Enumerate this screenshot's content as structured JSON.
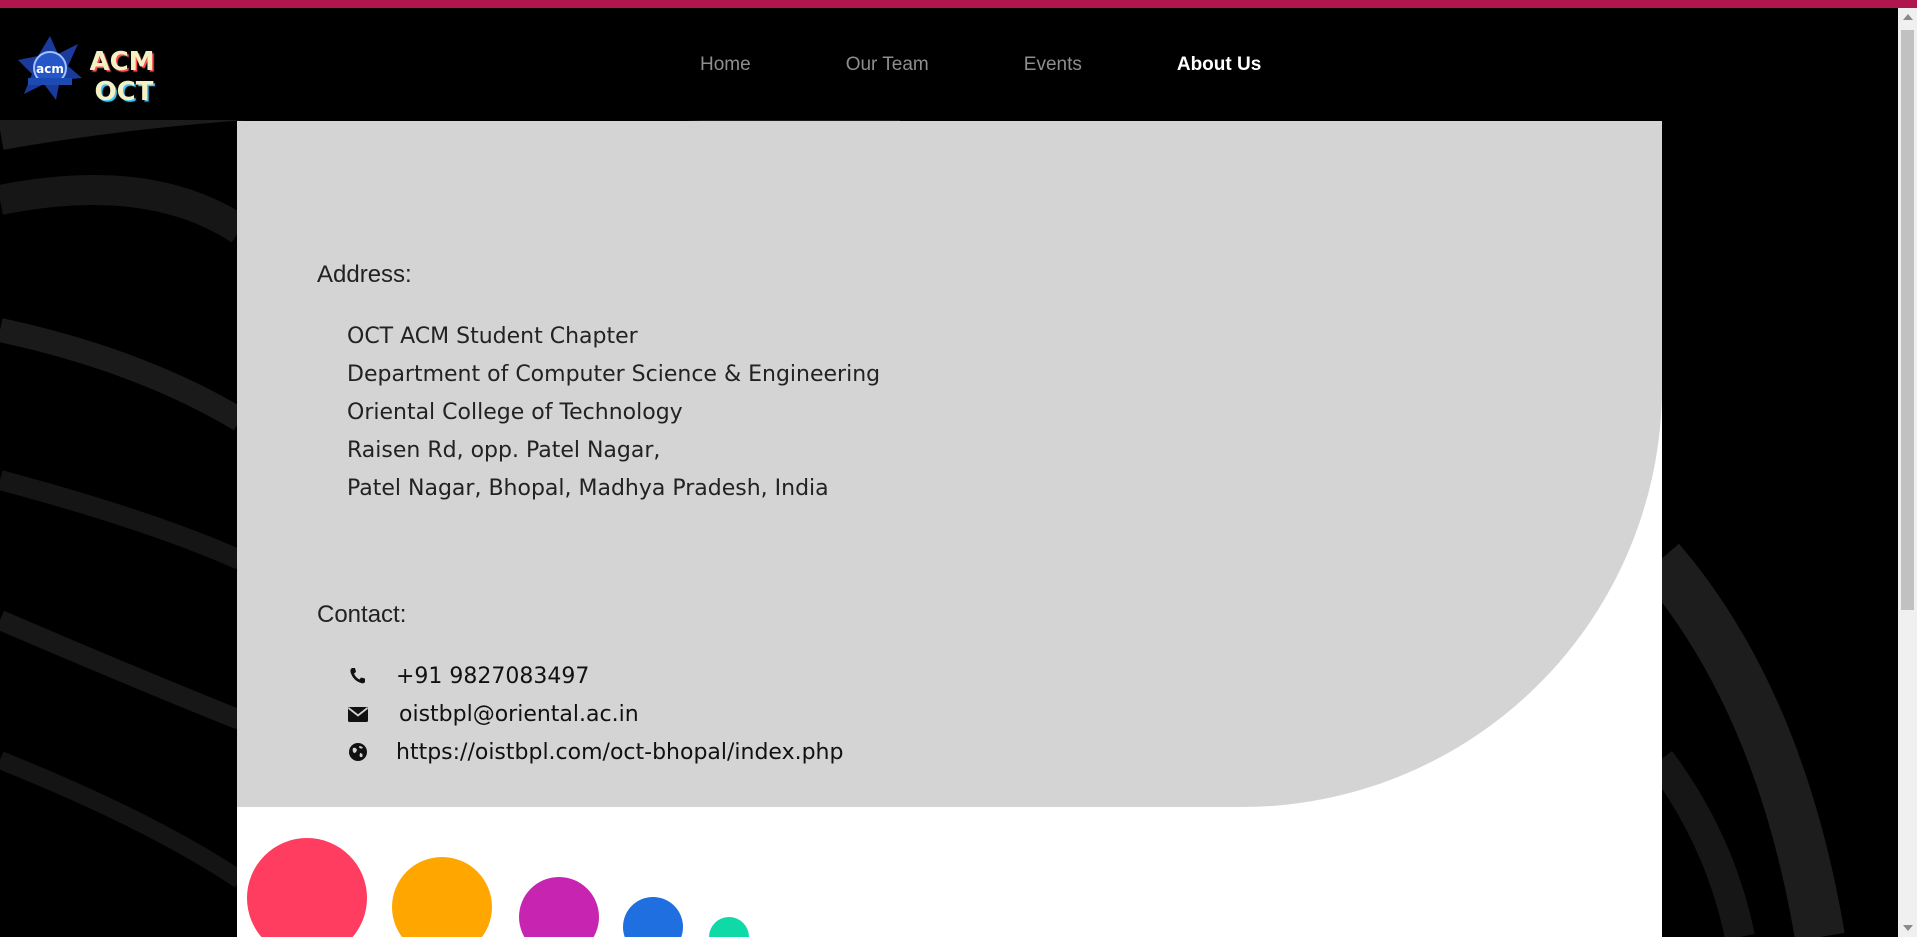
{
  "colors": {
    "top_stripe": "#b0164e",
    "nav_bg": "#000000",
    "nav_link": "#8e8e8e",
    "nav_active": "#ffffff",
    "panel_bg": "#d4d4d4",
    "card_bg": "#ffffff"
  },
  "logos": {
    "acm_icon": "acm-logo",
    "oct_icon": "acm-oct-logo",
    "acm_text": "acm",
    "oct_text_1": "ACM",
    "oct_text_2": "OCT"
  },
  "nav": {
    "items": [
      {
        "label": "Home",
        "active": false
      },
      {
        "label": "Our Team",
        "active": false
      },
      {
        "label": "Events",
        "active": false
      },
      {
        "label": "About Us",
        "active": true
      }
    ]
  },
  "address": {
    "heading": "Address:",
    "lines": [
      "OCT ACM Student Chapter",
      "Department of Computer Science & Engineering",
      "Oriental College of Technology",
      "Raisen Rd, opp. Patel Nagar,",
      "Patel Nagar, Bhopal, Madhya Pradesh, India"
    ]
  },
  "contact": {
    "heading": "Contact:",
    "items": [
      {
        "icon": "phone-icon",
        "text": "+91 9827083497"
      },
      {
        "icon": "envelope-icon",
        "text": "oistbpl@oriental.ac.in"
      },
      {
        "icon": "globe-icon",
        "text": "https://oistbpl.com/oct-bhopal/index.php"
      }
    ]
  },
  "decorative_circles": [
    "#ff3d60",
    "#ffa600",
    "#c724b1",
    "#1f6fe0",
    "#10d9a8"
  ]
}
